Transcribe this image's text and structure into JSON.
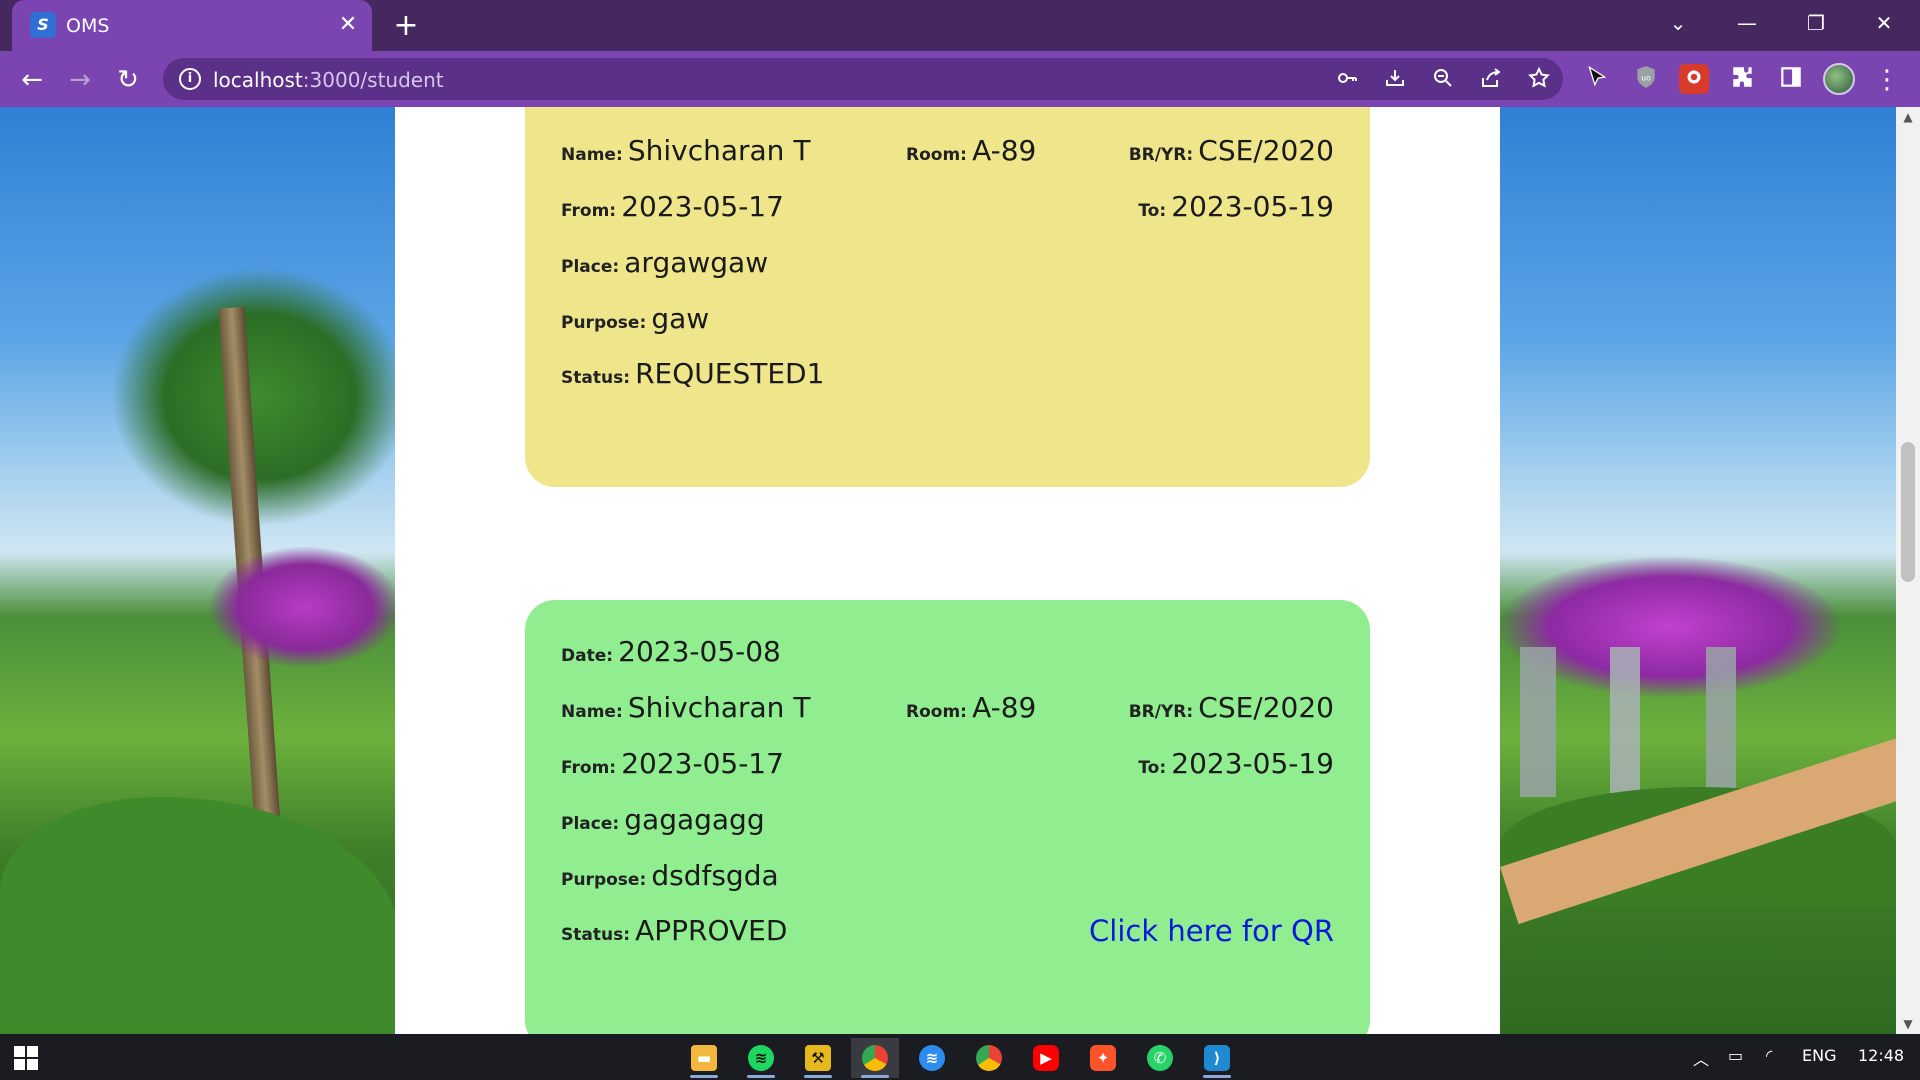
{
  "browser": {
    "tab_title": "OMS",
    "favicon_text": "S",
    "close_glyph": "✕",
    "new_tab_glyph": "+",
    "url_host": "localhost",
    "url_path": ":3000/student",
    "window_controls": {
      "dropdown": "⌄",
      "minimize": "—",
      "restore": "❐",
      "close": "✕"
    },
    "nav": {
      "back": "←",
      "forward": "→",
      "reload": "↻"
    },
    "omnibox_icons": [
      "key-icon",
      "install-icon",
      "zoom-out-icon",
      "share-icon",
      "star-icon"
    ],
    "extension_icons": [
      "cursor-extension-icon",
      "ublock-icon",
      "puzzle-red-extension-icon",
      "extensions-puzzle-icon",
      "side-panel-icon"
    ],
    "menu_glyph": "⋮"
  },
  "cards": [
    {
      "status_color": "#efe68c",
      "name_label": "Name:",
      "name": "Shivcharan T",
      "room_label": "Room:",
      "room": "A-89",
      "bryr_label": "BR/YR:",
      "bryr": "CSE/2020",
      "from_label": "From:",
      "from": "2023-05-17",
      "to_label": "To:",
      "to": "2023-05-19",
      "place_label": "Place:",
      "place": "argawgaw",
      "purpose_label": "Purpose:",
      "purpose": "gaw",
      "status_label": "Status:",
      "status": "REQUESTED1"
    },
    {
      "status_color": "#90ee90",
      "date_label": "Date:",
      "date": "2023-05-08",
      "name_label": "Name:",
      "name": "Shivcharan T",
      "room_label": "Room:",
      "room": "A-89",
      "bryr_label": "BR/YR:",
      "bryr": "CSE/2020",
      "from_label": "From:",
      "from": "2023-05-17",
      "to_label": "To:",
      "to": "2023-05-19",
      "place_label": "Place:",
      "place": "gagagagg",
      "purpose_label": "Purpose:",
      "purpose": "dsdfsgda",
      "status_label": "Status:",
      "status": "APPROVED",
      "qr_link": "Click here for QR"
    }
  ],
  "taskbar": {
    "apps": [
      "file-explorer-icon",
      "spotify-icon",
      "tool-app-icon",
      "chrome-icon",
      "spotify-alt-icon",
      "chrome-alt-icon",
      "youtube-icon",
      "brave-icon",
      "whatsapp-icon",
      "vscode-icon"
    ],
    "language": "ENG",
    "time": "12:48"
  }
}
